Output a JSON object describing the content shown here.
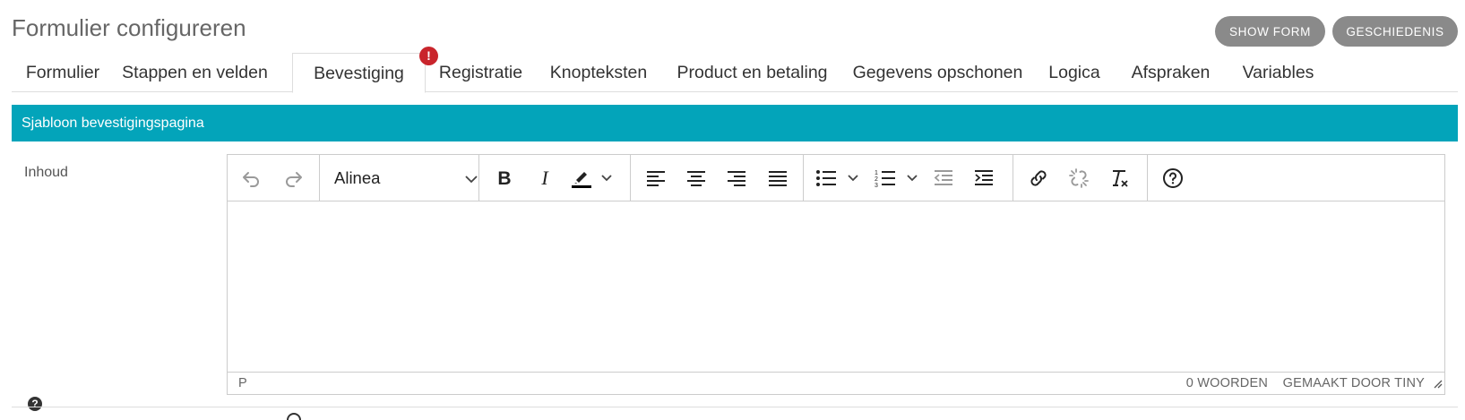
{
  "page": {
    "title": "Formulier configureren"
  },
  "header": {
    "show_form_label": "SHOW FORM",
    "history_label": "GESCHIEDENIS"
  },
  "tabs": [
    {
      "label": "Formulier"
    },
    {
      "label": "Stappen en velden"
    },
    {
      "label": "Bevestiging",
      "active": true,
      "badge": "!"
    },
    {
      "label": "Registratie"
    },
    {
      "label": "Knopteksten"
    },
    {
      "label": "Product en betaling"
    },
    {
      "label": "Gegevens opschonen"
    },
    {
      "label": "Logica"
    },
    {
      "label": "Afspraken"
    },
    {
      "label": "Variables"
    }
  ],
  "section": {
    "title": "Sjabloon bevestigingspagina"
  },
  "field": {
    "label": "Inhoud"
  },
  "editor": {
    "format_value": "Alinea",
    "status_path": "P",
    "word_count": "0 WOORDEN",
    "branding": "GEMAAKT DOOR TINY"
  },
  "colors": {
    "accent": "#03a4ba",
    "badge": "#c9252c",
    "button": "#8a8a8a"
  },
  "icons": [
    "undo-icon",
    "redo-icon",
    "bold-icon",
    "italic-icon",
    "highlight-icon",
    "align-left-icon",
    "align-center-icon",
    "align-right-icon",
    "align-justify-icon",
    "bullet-list-icon",
    "numbered-list-icon",
    "outdent-icon",
    "indent-icon",
    "link-icon",
    "unlink-icon",
    "clear-format-icon",
    "help-icon"
  ]
}
